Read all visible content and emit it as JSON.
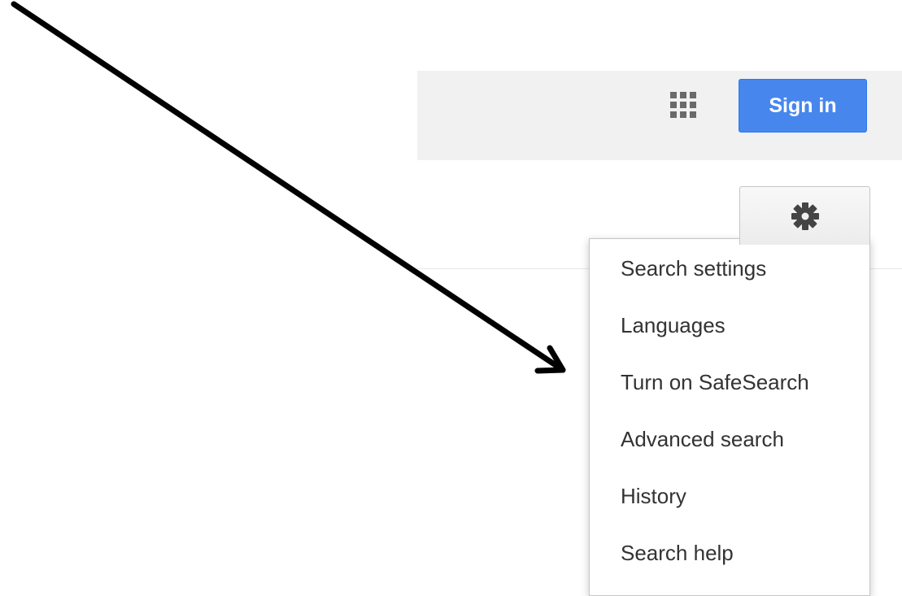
{
  "header": {
    "apps_icon": "apps-grid-icon",
    "sign_in_label": "Sign in",
    "accent_color": "#4787ed"
  },
  "settings": {
    "gear_icon": "gear-icon",
    "menu": {
      "items": [
        {
          "label": "Search settings"
        },
        {
          "label": "Languages"
        },
        {
          "label": "Turn on SafeSearch"
        },
        {
          "label": "Advanced search"
        },
        {
          "label": "History"
        },
        {
          "label": "Search help"
        }
      ]
    }
  },
  "annotation": {
    "arrow_color": "#000000"
  }
}
